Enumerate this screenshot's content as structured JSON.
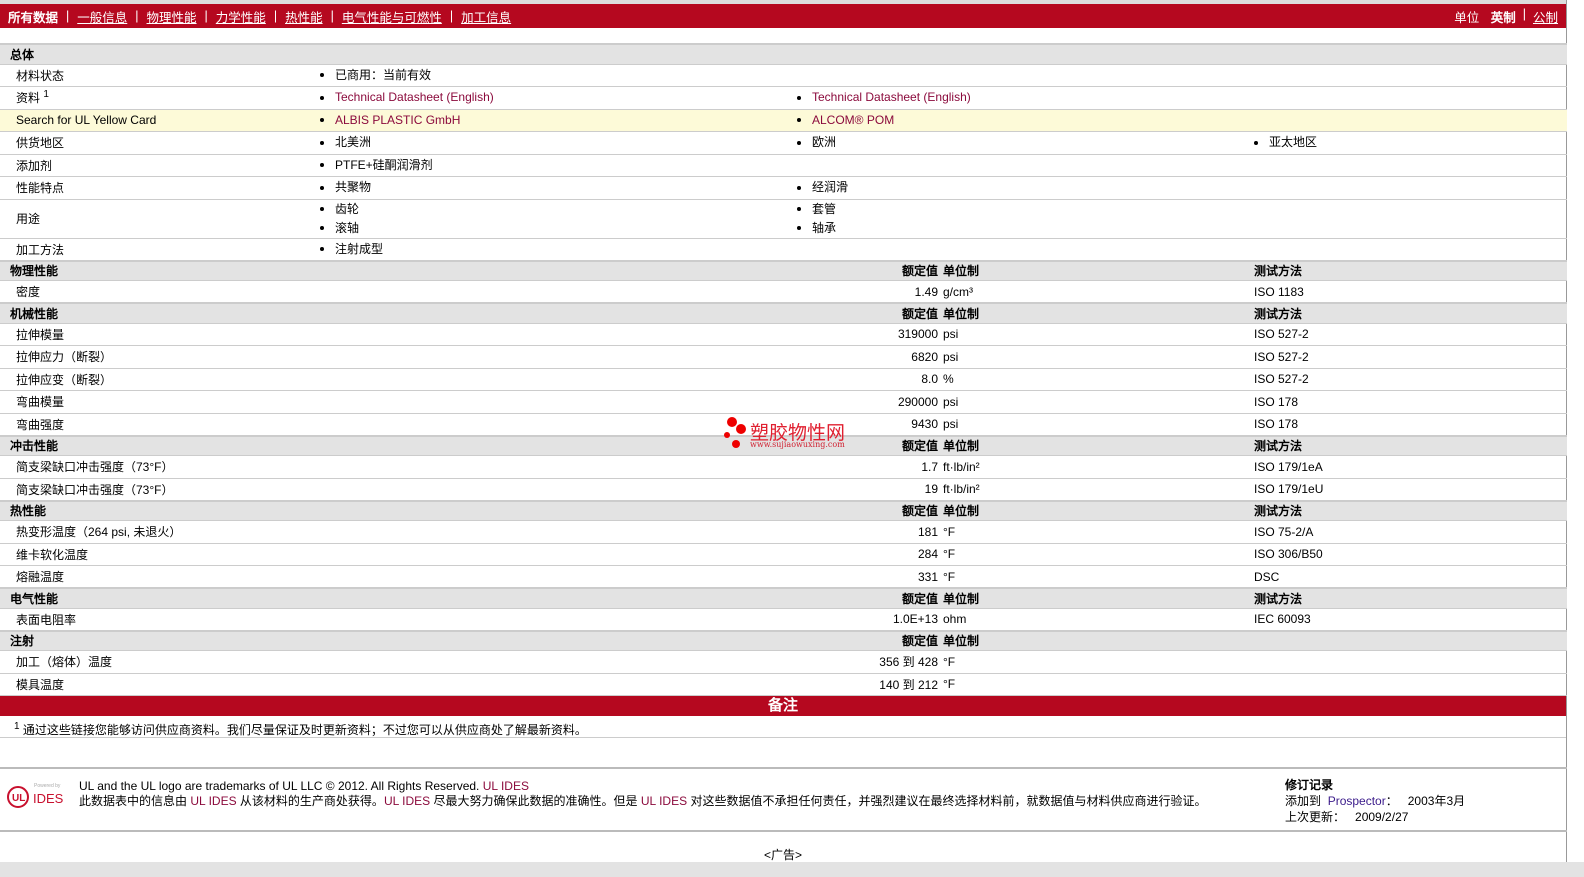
{
  "nav": {
    "items": [
      "所有数据",
      "一般信息",
      "物理性能",
      "力学性能",
      "热性能",
      "电气性能与可燃性",
      "加工信息"
    ],
    "unit_label": "单位",
    "unit_current": "英制",
    "unit_other": "公制"
  },
  "general": {
    "title": "总体",
    "rows": [
      {
        "label": "材料状态",
        "cols": [
          [
            "已商用：当前有效"
          ]
        ]
      },
      {
        "label": "资料",
        "sup": "1",
        "link": true,
        "cols": [
          [
            "Technical Datasheet (English)"
          ],
          [
            "Technical Datasheet (English)"
          ]
        ]
      },
      {
        "label": "Search for UL Yellow Card",
        "link": true,
        "yellow": true,
        "cols": [
          [
            "ALBIS PLASTIC GmbH"
          ],
          [
            "ALCOM® POM"
          ]
        ]
      },
      {
        "label": "供货地区",
        "cols": [
          [
            "北美洲"
          ],
          [
            "欧洲"
          ],
          [
            "亚太地区"
          ]
        ]
      },
      {
        "label": "添加剂",
        "cols": [
          [
            "PTFE+硅酮润滑剂"
          ]
        ]
      },
      {
        "label": "性能特点",
        "cols": [
          [
            "共聚物"
          ],
          [
            "经润滑"
          ]
        ]
      },
      {
        "label": "用途",
        "cols": [
          [
            "齿轮",
            "滚轴"
          ],
          [
            "套管",
            "轴承"
          ]
        ]
      },
      {
        "label": "加工方法",
        "cols": [
          [
            "注射成型"
          ]
        ]
      }
    ]
  },
  "headers": {
    "value": "额定值",
    "unit": "单位制",
    "test": "测试方法"
  },
  "sections": [
    {
      "title": "物理性能",
      "test": true,
      "rows": [
        {
          "label": "密度",
          "value": "1.49",
          "unit": "g/cm³",
          "test": "ISO 1183"
        }
      ]
    },
    {
      "title": "机械性能",
      "test": true,
      "rows": [
        {
          "label": "拉伸模量",
          "value": "319000",
          "unit": "psi",
          "test": "ISO 527-2"
        },
        {
          "label": "拉伸应力（断裂）",
          "value": "6820",
          "unit": "psi",
          "test": "ISO 527-2"
        },
        {
          "label": "拉伸应变（断裂）",
          "value": "8.0",
          "unit": "%",
          "test": "ISO 527-2"
        },
        {
          "label": "弯曲模量",
          "value": "290000",
          "unit": "psi",
          "test": "ISO 178"
        },
        {
          "label": "弯曲强度",
          "value": "9430",
          "unit": "psi",
          "test": "ISO 178"
        }
      ]
    },
    {
      "title": "冲击性能",
      "test": true,
      "rows": [
        {
          "label": "简支梁缺口冲击强度（73°F）",
          "value": "1.7",
          "unit": "ft·lb/in²",
          "test": "ISO 179/1eA"
        },
        {
          "label": "简支梁缺口冲击强度（73°F）",
          "value": "19",
          "unit": "ft·lb/in²",
          "test": "ISO 179/1eU"
        }
      ]
    },
    {
      "title": "热性能",
      "test": true,
      "rows": [
        {
          "label": "热变形温度（264 psi, 未退火）",
          "value": "181",
          "unit": "°F",
          "test": "ISO 75-2/A"
        },
        {
          "label": "维卡软化温度",
          "value": "284",
          "unit": "°F",
          "test": "ISO 306/B50"
        },
        {
          "label": "熔融温度",
          "value": "331",
          "unit": "°F",
          "test": "DSC"
        }
      ]
    },
    {
      "title": "电气性能",
      "test": true,
      "rows": [
        {
          "label": "表面电阻率",
          "value": "1.0E+13",
          "unit": "ohm",
          "test": "IEC 60093"
        }
      ]
    },
    {
      "title": "注射",
      "test": false,
      "rows": [
        {
          "label": "加工（熔体）温度",
          "value": "356 到  428",
          "unit": "°F",
          "test": ""
        },
        {
          "label": "模具温度",
          "value": "140 到  212",
          "unit": "°F",
          "test": ""
        }
      ]
    }
  ],
  "notes": {
    "title": "备注",
    "sup": "1",
    "text": "通过这些链接您能够访问供应商资料。我们尽量保证及时更新资料；不过您可以从供应商处了解最新资料。"
  },
  "footer": {
    "logo_text": "UL IDES",
    "powered": "Powered by",
    "line1": "UL and the UL logo are trademarks of UL LLC © 2012. All Rights Reserved.",
    "line1_link": "UL IDES",
    "line2_a": "此数据表中的信息由 ",
    "line2_link1": "UL IDES",
    "line2_b": " 从该材料的生产商处获得。",
    "line2_link2": "UL IDES",
    "line2_c": " 尽最大努力确保此数据的准确性。但是 ",
    "line2_link3": "UL IDES",
    "line2_d": " 对这些数据值不承担任何责任，并强烈建议在最终选择材料前，就数据值与材料供应商进行验证。",
    "rev_title": "修订记录",
    "added_label": "添加到",
    "added_link": "Prospector",
    "added_sep": "：",
    "added_date": "2003年3月",
    "updated_label": "上次更新：",
    "updated_date": "2009/2/27"
  },
  "ad": "<广告>",
  "watermark": {
    "text": "塑胶物性网",
    "url": "www.sujiaowuxing.com"
  }
}
